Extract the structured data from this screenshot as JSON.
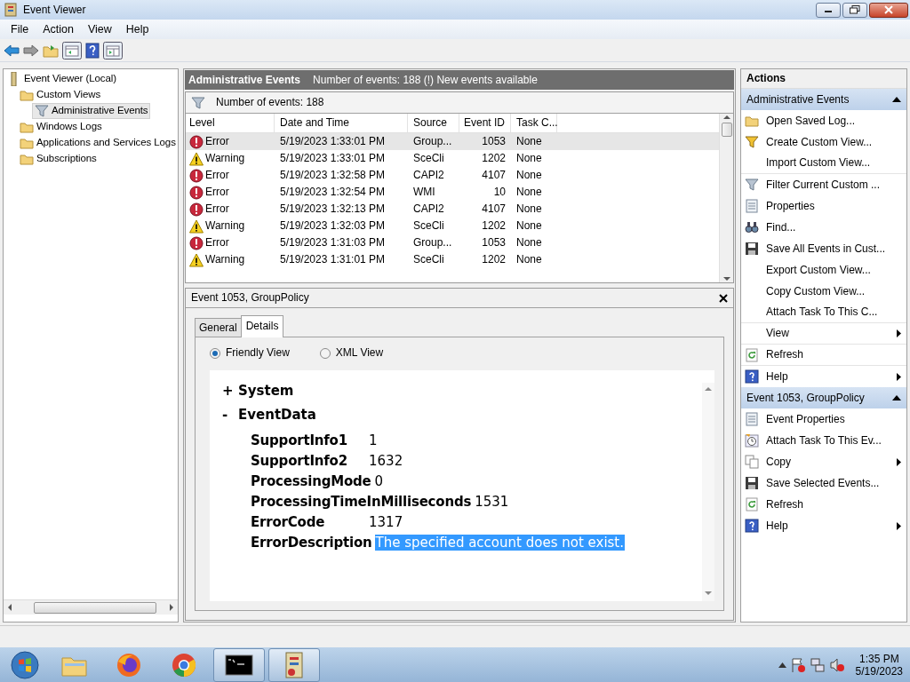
{
  "window": {
    "title": "Event Viewer"
  },
  "menu": [
    "File",
    "Action",
    "View",
    "Help"
  ],
  "tree": [
    {
      "label": "Event Viewer (Local)",
      "kind": "root",
      "selected": false,
      "children": [
        {
          "label": "Custom Views",
          "kind": "folder",
          "selected": false,
          "children": [
            {
              "label": "Administrative Events",
              "kind": "filter",
              "selected": true
            }
          ]
        },
        {
          "label": "Windows Logs",
          "kind": "folder",
          "selected": false
        },
        {
          "label": "Applications and Services Logs",
          "kind": "folder",
          "selected": false
        },
        {
          "label": "Subscriptions",
          "kind": "folder",
          "selected": false
        }
      ]
    }
  ],
  "header": {
    "title": "Administrative Events",
    "info": "Number of events: 188 (!) New events available"
  },
  "filter_bar": {
    "text": "Number of events: 188"
  },
  "table": {
    "columns": [
      "Level",
      "Date and Time",
      "Source",
      "Event ID",
      "Task C..."
    ],
    "rows": [
      {
        "kind": "error",
        "level": "Error",
        "date": "5/19/2023 1:33:01 PM",
        "source": "Group...",
        "event_id": "1053",
        "task": "None",
        "selected": true
      },
      {
        "kind": "warning",
        "level": "Warning",
        "date": "5/19/2023 1:33:01 PM",
        "source": "SceCli",
        "event_id": "1202",
        "task": "None",
        "selected": false
      },
      {
        "kind": "error",
        "level": "Error",
        "date": "5/19/2023 1:32:58 PM",
        "source": "CAPI2",
        "event_id": "4107",
        "task": "None",
        "selected": false
      },
      {
        "kind": "error",
        "level": "Error",
        "date": "5/19/2023 1:32:54 PM",
        "source": "WMI",
        "event_id": "10",
        "task": "None",
        "selected": false
      },
      {
        "kind": "error",
        "level": "Error",
        "date": "5/19/2023 1:32:13 PM",
        "source": "CAPI2",
        "event_id": "4107",
        "task": "None",
        "selected": false
      },
      {
        "kind": "warning",
        "level": "Warning",
        "date": "5/19/2023 1:32:03 PM",
        "source": "SceCli",
        "event_id": "1202",
        "task": "None",
        "selected": false
      },
      {
        "kind": "error",
        "level": "Error",
        "date": "5/19/2023 1:31:03 PM",
        "source": "Group...",
        "event_id": "1053",
        "task": "None",
        "selected": false
      },
      {
        "kind": "warning",
        "level": "Warning",
        "date": "5/19/2023 1:31:01 PM",
        "source": "SceCli",
        "event_id": "1202",
        "task": "None",
        "selected": false
      }
    ]
  },
  "details": {
    "title": "Event 1053, GroupPolicy",
    "tabs": [
      {
        "label": "General",
        "selected": false
      },
      {
        "label": "Details",
        "selected": true
      }
    ],
    "views": [
      {
        "label": "Friendly View",
        "selected": true
      },
      {
        "label": "XML View",
        "selected": false
      }
    ],
    "sections": [
      {
        "toggle": "+",
        "name": "System"
      },
      {
        "toggle": "-",
        "name": "EventData",
        "fields": [
          {
            "name": "SupportInfo1",
            "value": "1",
            "selected": false
          },
          {
            "name": "SupportInfo2",
            "value": "1632",
            "selected": false
          },
          {
            "name": "ProcessingMode",
            "value": "0",
            "selected": false
          },
          {
            "name": "ProcessingTimeInMilliseconds",
            "value": "1531",
            "selected": false
          },
          {
            "name": "ErrorCode",
            "value": "1317",
            "selected": false
          },
          {
            "name": "ErrorDescription",
            "value": "The specified account does not exist.",
            "selected": true
          }
        ]
      }
    ]
  },
  "actions": {
    "title": "Actions",
    "sections": [
      {
        "title": "Administrative Events",
        "items": [
          {
            "label": "Open Saved Log...",
            "kind": "open",
            "submenu": false,
            "separator_after": false
          },
          {
            "label": "Create Custom View...",
            "kind": "funnel",
            "submenu": false,
            "separator_after": false
          },
          {
            "label": "Import Custom View...",
            "kind": "plain",
            "submenu": false,
            "separator_after": true
          },
          {
            "label": "Filter Current Custom ...",
            "kind": "filter",
            "submenu": false,
            "separator_after": false
          },
          {
            "label": "Properties",
            "kind": "properties",
            "submenu": false,
            "separator_after": false
          },
          {
            "label": "Find...",
            "kind": "find",
            "submenu": false,
            "separator_after": false
          },
          {
            "label": "Save All Events in Cust...",
            "kind": "save",
            "submenu": false,
            "separator_after": false
          },
          {
            "label": "Export Custom View...",
            "kind": "plain",
            "submenu": false,
            "separator_after": false
          },
          {
            "label": "Copy Custom View...",
            "kind": "plain",
            "submenu": false,
            "separator_after": false
          },
          {
            "label": "Attach Task To This C...",
            "kind": "plain",
            "submenu": false,
            "separator_after": true
          },
          {
            "label": "View",
            "kind": "plain",
            "submenu": true,
            "separator_after": true
          },
          {
            "label": "Refresh",
            "kind": "refresh",
            "submenu": false,
            "separator_after": true
          },
          {
            "label": "Help",
            "kind": "help",
            "submenu": true,
            "separator_after": false
          }
        ]
      },
      {
        "title": "Event 1053, GroupPolicy",
        "items": [
          {
            "label": "Event Properties",
            "kind": "properties",
            "submenu": false,
            "separator_after": false
          },
          {
            "label": "Attach Task To This Ev...",
            "kind": "task",
            "submenu": false,
            "separator_after": false
          },
          {
            "label": "Copy",
            "kind": "copy",
            "submenu": true,
            "separator_after": false
          },
          {
            "label": "Save Selected Events...",
            "kind": "save",
            "submenu": false,
            "separator_after": false
          },
          {
            "label": "Refresh",
            "kind": "refresh",
            "submenu": false,
            "separator_after": false
          },
          {
            "label": "Help",
            "kind": "help",
            "submenu": true,
            "separator_after": false
          }
        ]
      }
    ]
  },
  "taskbar": {
    "apps": [
      {
        "kind": "folder",
        "active": false
      },
      {
        "kind": "firefox",
        "active": false
      },
      {
        "kind": "chrome",
        "active": false
      },
      {
        "kind": "terminal",
        "active": true
      },
      {
        "kind": "eventviewer",
        "active": true
      }
    ],
    "time": "1:35 PM",
    "date": "5/19/2023"
  }
}
